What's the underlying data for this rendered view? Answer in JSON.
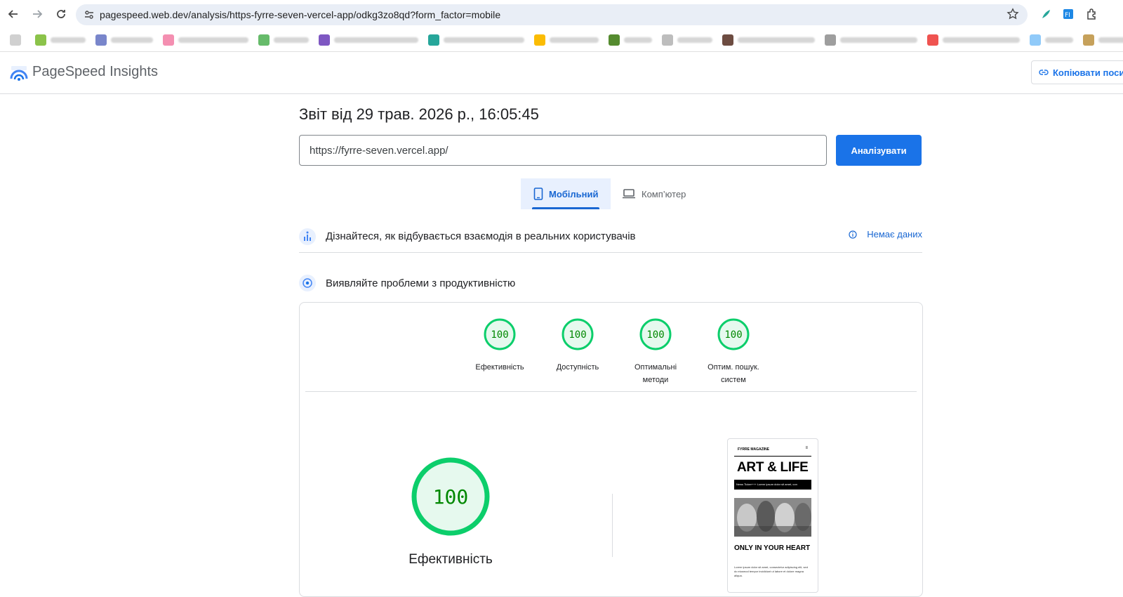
{
  "browser": {
    "url": "pagespeed.web.dev/analysis/https-fyrre-seven-vercel-app/odkg3zo8qd?form_factor=mobile"
  },
  "app": {
    "title": "PageSpeed Insights",
    "copy_link_label": "Копіювати поси"
  },
  "report": {
    "date_label": "Звіт від 29 трав. 2026 р., 16:05:45",
    "url_value": "https://fyrre-seven.vercel.app/",
    "analyze_label": "Аналізувати"
  },
  "tabs": [
    {
      "label": "Мобільний",
      "selected": true
    },
    {
      "label": "Комп’ютер",
      "selected": false
    }
  ],
  "field_data": {
    "title": "Дізнайтеся, як відбувається взаємодія в реальних користувачів",
    "no_data_label": "Немає даних"
  },
  "lab": {
    "title": "Виявляйте проблеми з продуктивністю",
    "scores": [
      {
        "value": "100",
        "label_line1": "Ефективність",
        "label_line2": ""
      },
      {
        "value": "100",
        "label_line1": "Доступність",
        "label_line2": ""
      },
      {
        "value": "100",
        "label_line1": "Оптимальні",
        "label_line2": "методи"
      },
      {
        "value": "100",
        "label_line1": "Оптим. пошук.",
        "label_line2": "систем"
      }
    ],
    "main_score": {
      "value": "100",
      "label": "Ефективність",
      "fraction": 1.0
    }
  },
  "preview": {
    "brand": "FYRRE MAGAZINE",
    "headline": "ART & LIFE",
    "ticker": "News Ticker+++   Lorem ipsum dolor sit amet, con",
    "subheadline": "ONLY IN YOUR HEART",
    "body": "Lorem ipsum dolor sit amet, consectetur adipiscing elit, sed do eiusmod tempor incididunt ut labore et dolore magna aliqua."
  },
  "colors": {
    "accent": "#1a73e8",
    "score_good": "#0cce6b",
    "score_text": "#008800",
    "score_fill": "#e6f9ee"
  }
}
